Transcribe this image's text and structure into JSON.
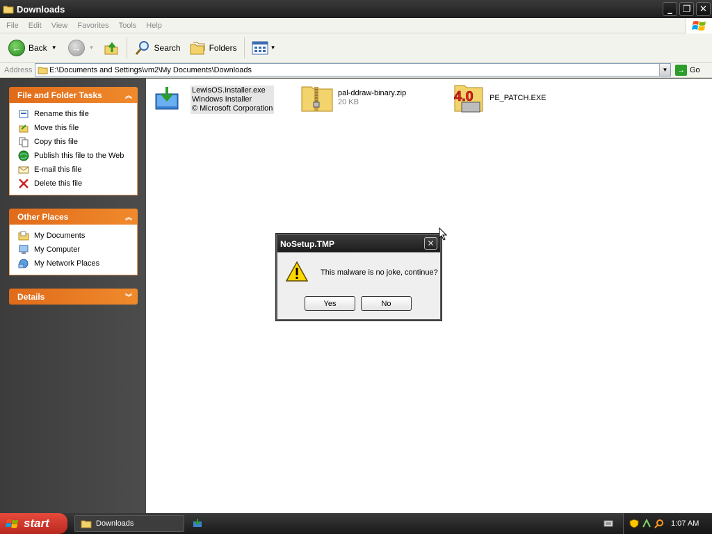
{
  "window": {
    "title": "Downloads"
  },
  "menubar": {
    "items": [
      "File",
      "Edit",
      "View",
      "Favorites",
      "Tools",
      "Help"
    ]
  },
  "toolbar": {
    "back": "Back",
    "search": "Search",
    "folders": "Folders"
  },
  "address": {
    "label": "Address",
    "path": "E:\\Documents and Settings\\vm2\\My Documents\\Downloads",
    "go": "Go"
  },
  "tasks_panel": {
    "title": "File and Folder Tasks",
    "items": [
      {
        "label": "Rename this file",
        "icon": "rename-icon"
      },
      {
        "label": "Move this file",
        "icon": "move-icon"
      },
      {
        "label": "Copy this file",
        "icon": "copy-icon"
      },
      {
        "label": "Publish this file to the Web",
        "icon": "publish-icon"
      },
      {
        "label": "E-mail this file",
        "icon": "email-icon"
      },
      {
        "label": "Delete this file",
        "icon": "delete-icon"
      }
    ]
  },
  "places_panel": {
    "title": "Other Places",
    "items": [
      {
        "label": "My Documents",
        "icon": "my-documents-icon"
      },
      {
        "label": "My Computer",
        "icon": "my-computer-icon"
      },
      {
        "label": "My Network Places",
        "icon": "network-places-icon"
      }
    ]
  },
  "details_panel": {
    "title": "Details"
  },
  "files": [
    {
      "name": "LewisOS.Installer.exe",
      "line2": "Windows Installer",
      "line3": "© Microsoft Corporation"
    },
    {
      "name": "pal-ddraw-binary.zip",
      "line2": "20 KB"
    },
    {
      "name": "PE_PATCH.EXE",
      "icon_text": "4.0"
    }
  ],
  "dialog": {
    "title": "NoSetup.TMP",
    "message": "This malware is no joke, continue?",
    "yes": "Yes",
    "no": "No"
  },
  "taskbar": {
    "start": "start",
    "window": "Downloads",
    "clock": "1:07 AM"
  }
}
